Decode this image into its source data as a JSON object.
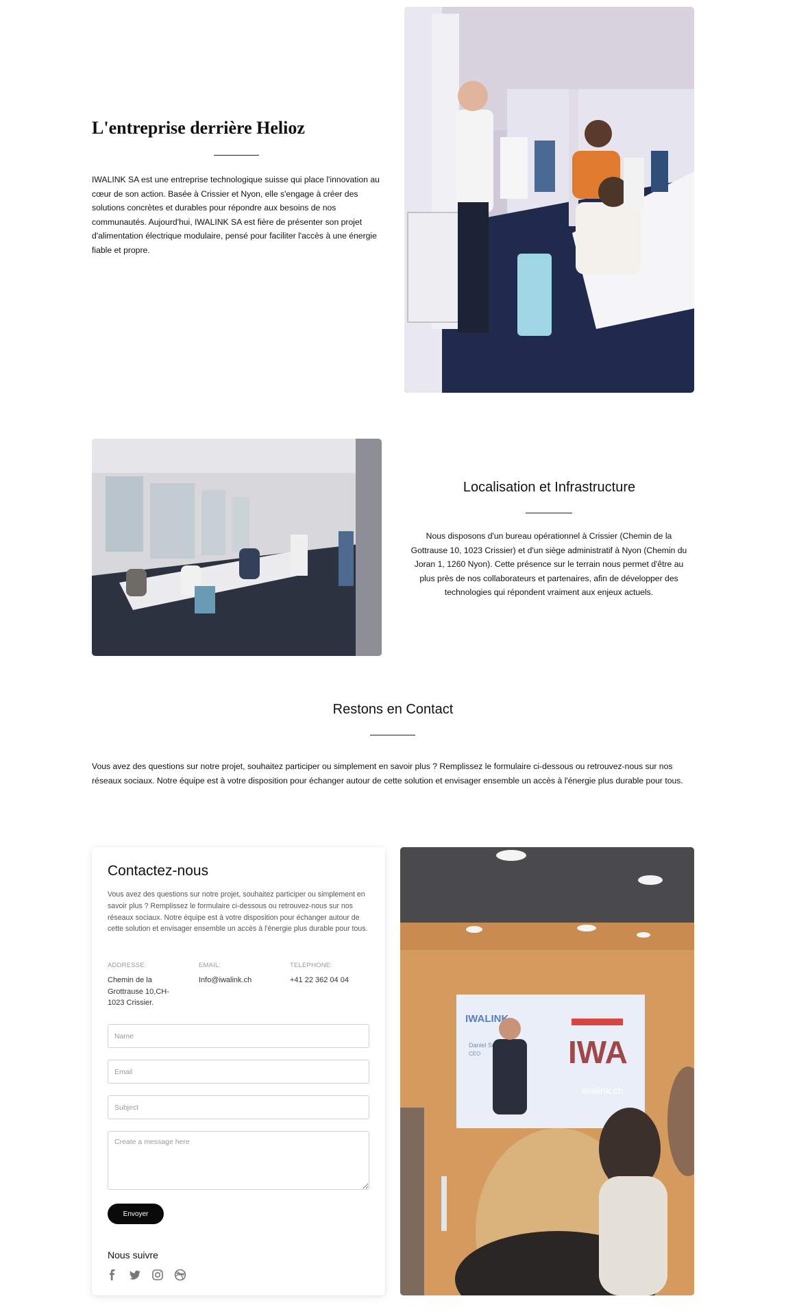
{
  "about": {
    "title": "L'entreprise derrière Helioz",
    "body": "IWALINK SA est une entreprise technologique suisse qui place l'innovation au cœur de son action. Basée à Crissier et Nyon, elle s'engage à créer des solutions concrètes et durables pour répondre aux besoins de nos communautés. Aujourd'hui, IWALINK SA est fière de présenter son projet d'alimentation électrique modulaire, pensé pour faciliter l'accès à une énergie fiable et propre."
  },
  "location": {
    "title": "Localisation et Infrastructure",
    "body": "Nous disposons d'un bureau opérationnel à Crissier (Chemin de la Gottrause 10, 1023 Crissier) et d'un siège administratif à Nyon (Chemin du Joran 1, 1260 Nyon). Cette présence sur le terrain nous permet d'être au plus près de nos collaborateurs et partenaires, afin de développer des technologies qui répondent vraiment aux enjeux actuels."
  },
  "contact_intro": {
    "title": "Restons en Contact",
    "body": "Vous avez des questions sur notre projet, souhaitez participer ou simplement en savoir plus ? Remplissez le formulaire ci-dessous ou retrouvez-nous sur nos réseaux sociaux. Notre équipe est à votre disposition pour échanger autour de cette solution et envisager ensemble un accès à l'énergie plus durable pour tous."
  },
  "contact_card": {
    "title": "Contactez-nous",
    "body": "Vous avez des questions sur notre projet, souhaitez participer ou simplement en savoir plus ? Remplissez le formulaire ci-dessous ou retrouvez-nous sur nos réseaux sociaux. Notre équipe est à votre disposition pour échanger autour de cette solution et envisager ensemble un accès à l'énergie plus durable pour tous.",
    "address_label": "ADDRESSE:",
    "address_value": "Chemin de la Grottrause 10,CH-1023 Crissier.",
    "email_label": "EMAIL:",
    "email_value": "Info@iwalink.ch",
    "phone_label": "TELEPHONE:",
    "phone_value": "+41 22 362 04 04",
    "name_placeholder": "Name",
    "email_placeholder": "Email",
    "subject_placeholder": "Subject",
    "message_placeholder": "Create a message here",
    "send_label": "Envoyer",
    "follow_label": "Nous suivre",
    "social_icons": [
      "facebook-icon",
      "twitter-icon",
      "instagram-icon",
      "dribbble-icon"
    ]
  },
  "event_photo": {
    "screen_brand": "IWALINK",
    "screen_logo": "IWA",
    "screen_name": "Daniel Serre",
    "screen_role": "CEO",
    "screen_url": "iwalink.ch"
  }
}
